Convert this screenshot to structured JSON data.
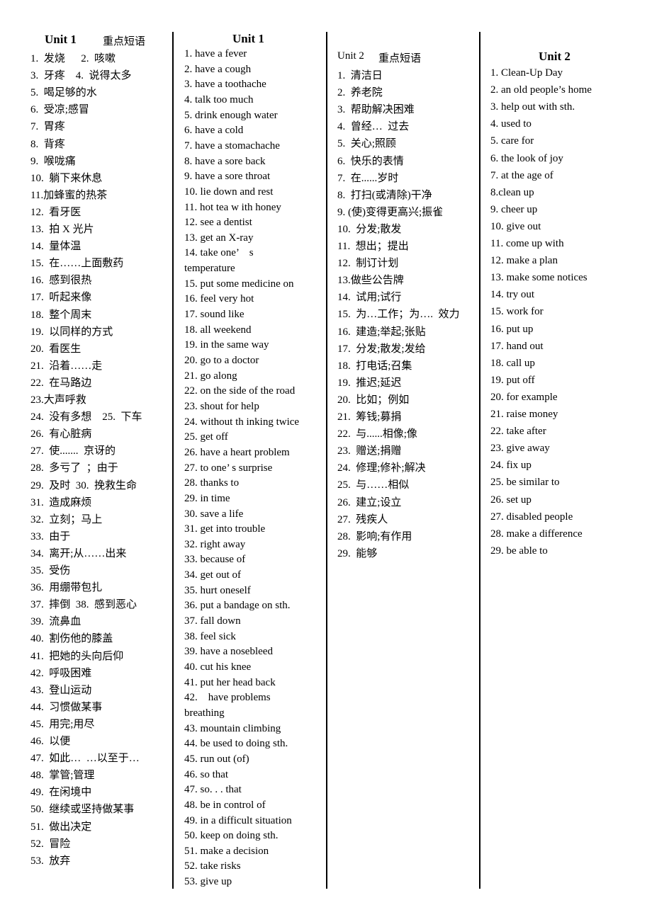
{
  "col1": {
    "title": "Unit 1",
    "subtitle": "重点短语",
    "lines": [
      "1.  发烧      2.  咳嗽",
      "3.  牙疼    4.  说得太多",
      "5.  喝足够的水",
      "6.  受凉;感冒",
      "7.  胃疼",
      "8.  背疼",
      "9.  喉咙痛",
      "10.  躺下来休息",
      "11.加蜂蜜的热茶",
      "12.  看牙医",
      "13.  拍 X 光片",
      "14.  量体温",
      "15.  在……上面敷药",
      "16.  感到很热",
      "17.  听起来像",
      "18.  整个周末",
      "19.  以同样的方式",
      "20.  看医生",
      "21.  沿着……走",
      "22.  在马路边",
      "23.大声呼救",
      "24.  没有多想    25.  下车",
      "26.  有心脏病",
      "27.  使.......  京讶的",
      "28.  多亏了  ；由于",
      "29.  及时  30.  挽救生命",
      "31.  造成麻烦",
      "32.  立刻；马上",
      "33.  由于",
      "34.  离开;从……出来",
      "35.  受伤",
      "36.  用绷带包扎",
      "37.  摔倒  38.  感到恶心",
      "39.  流鼻血",
      "40.  割伤他的膝盖",
      "41.  把她的头向后仰",
      "42.  呼吸困难",
      "43.  登山运动",
      "44.  习惯做某事",
      "45.  用完;用尽",
      "46.  以便",
      "47.  如此…  …以至于…",
      "48.  掌管;管理",
      "49.  在闲境中",
      "50.  继续或坚持做某事",
      "51.  做出决定",
      "52.  冒险",
      "53.  放弃"
    ]
  },
  "col2": {
    "title": "Unit 1",
    "lines": [
      "1. have a fever",
      "2. have a cough",
      "3. have a toothache",
      "4. talk too much",
      "5. drink enough water",
      "6. have a cold",
      "7. have a stomachache",
      "8. have a sore back",
      "9. have a sore throat",
      "10. lie down and rest",
      "11. hot tea w ith honey",
      "12. see a dentist",
      "13. get an X-ray",
      "14. take one’    s",
      "temperature",
      "15. put some medicine on",
      "16. feel very hot",
      "17. sound like",
      "18. all weekend",
      "19. in the same way",
      "20. go to a doctor",
      "21. go along",
      "22. on the side of the road",
      "23. shout for help",
      "24. without th inking twice",
      "25. get off",
      "26. have a heart problem",
      "27. to one’ s surprise",
      "28. thanks to",
      "29. in time",
      "30. save a life",
      "31. get into trouble",
      "32. right away",
      "33. because of",
      "34. get out of",
      "35. hurt oneself",
      "36. put a bandage on sth.",
      "37. fall down",
      "38. feel sick",
      "39. have a nosebleed",
      "40. cut his knee",
      "41. put her head back",
      "42.    have problems",
      "breathing",
      "43. mountain climbing",
      "44. be used to doing sth.",
      "45. run out (of)",
      "46. so that",
      "47. so. . . that",
      "48. be in control of",
      "49. in a difficult situation",
      "50. keep on doing sth.",
      "51. make a decision",
      "52. take risks",
      "53. give up"
    ]
  },
  "col3": {
    "title": "Unit 2",
    "subtitle": "重点短语",
    "lines": [
      "1.  清洁日",
      "2.  养老院",
      "3.  帮助解决困难",
      "4.  曾经…  过去",
      "5.  关心;照顾",
      "6.  快乐的表情",
      "7.  在......岁时",
      "8.  打扫(或清除)干净",
      "9. (使)变得更高兴;振雀",
      "10.  分发;散发",
      "11.  想出；提出",
      "12.  制订计划",
      "13.做些公告牌",
      "14.  试用;试行",
      "15.  为…工作；为….  效力",
      "16.  建造;举起;张贴",
      "17.  分发;散发;发给",
      "18.  打电话;召集",
      "19.  推迟;延迟",
      "20.  比如；例如",
      "21.  筹钱;募捐",
      "22.  与......相像;像",
      "23.  赠送;捐赠",
      "24.  修理;修补;解决",
      "25.  与……相似",
      "26.  建立;设立",
      "27.  残疾人",
      "28.  影响;有作用",
      "29.  能够"
    ]
  },
  "col4": {
    "title": "Unit 2",
    "lines": [
      "1. Clean-Up Day",
      "2. an old people’s home",
      "3. help out with sth.",
      "4. used to",
      "5. care for",
      "6. the look of joy",
      "7. at the age of",
      "8.clean up",
      "9. cheer up",
      "10. give out",
      "11. come up with",
      "12. make a plan",
      "13. make some notices",
      "14. try out",
      "15. work for",
      "16. put up",
      "17. hand out",
      "18. call up",
      "19. put off",
      "20. for example",
      "21. raise money",
      "22. take after",
      "23. give away",
      "24. fix up",
      "25. be similar to",
      "26. set up",
      "27. disabled people",
      "28. make a difference",
      "29. be able to"
    ]
  }
}
